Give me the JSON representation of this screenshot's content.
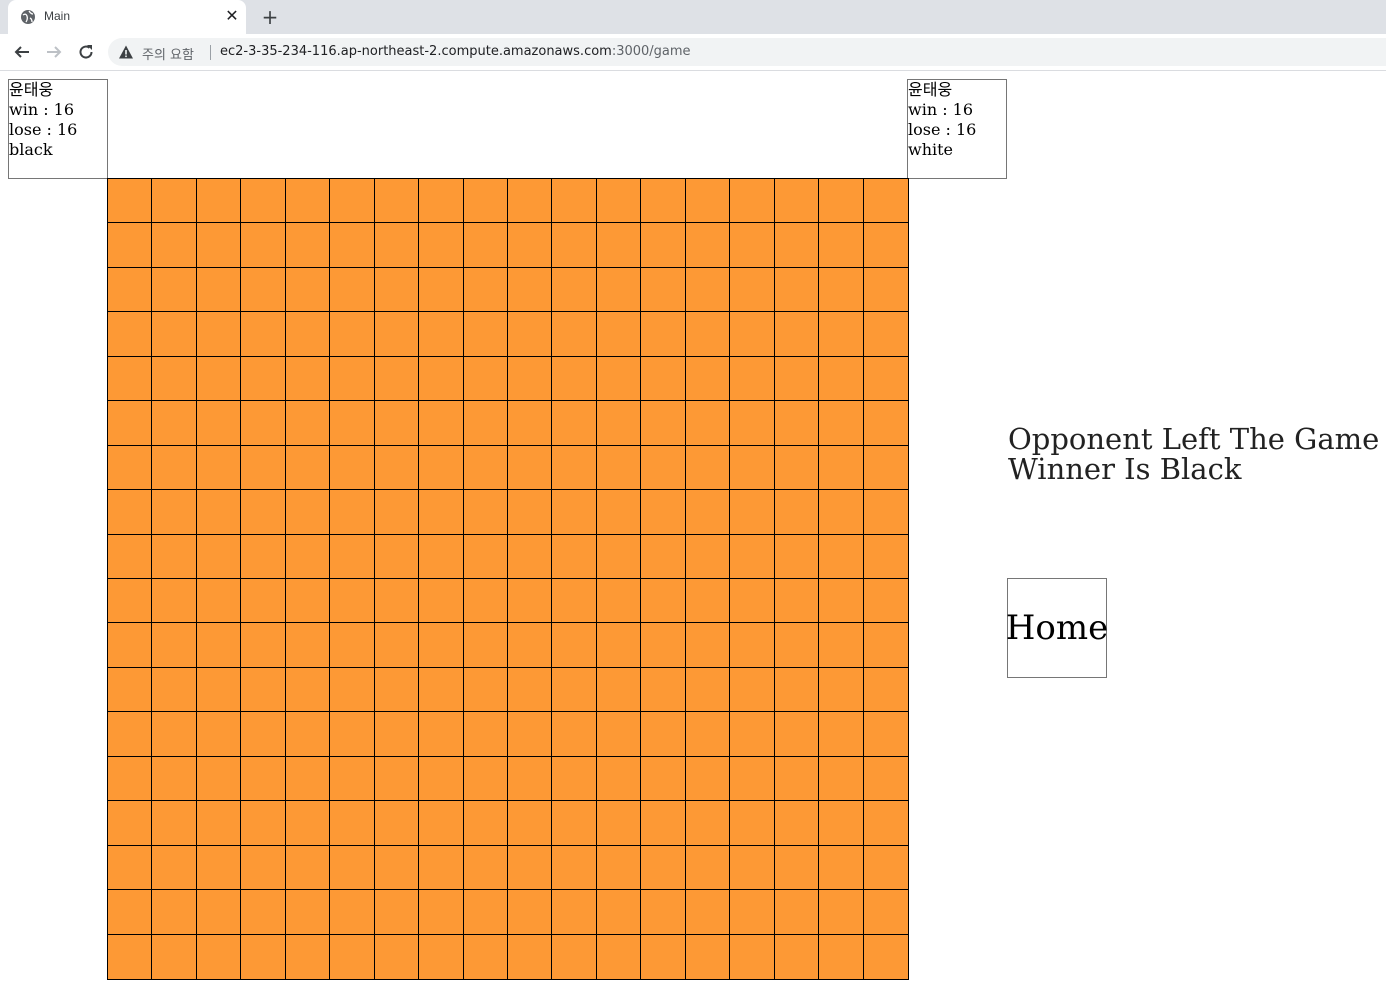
{
  "browser": {
    "tab_title": "Main",
    "tab_close": "✕",
    "new_tab": "+",
    "security_warning": "주의 요함",
    "url_host": "ec2-3-35-234-116.ap-northeast-2.compute.amazonaws.com",
    "url_path": ":3000/game"
  },
  "players": {
    "left": {
      "name": "윤태웅",
      "win": "win : 16",
      "lose": "lose : 16",
      "color": "black"
    },
    "right": {
      "name": "윤태웅",
      "win": "win : 16",
      "lose": "lose : 16",
      "color": "white"
    }
  },
  "board": {
    "rows": 18,
    "cols": 18,
    "color": "#fd9935",
    "line_color": "#000000"
  },
  "status": {
    "line1": "Opponent Left The Game",
    "line2": "Winner Is Black"
  },
  "home_button": {
    "label": "Home"
  }
}
